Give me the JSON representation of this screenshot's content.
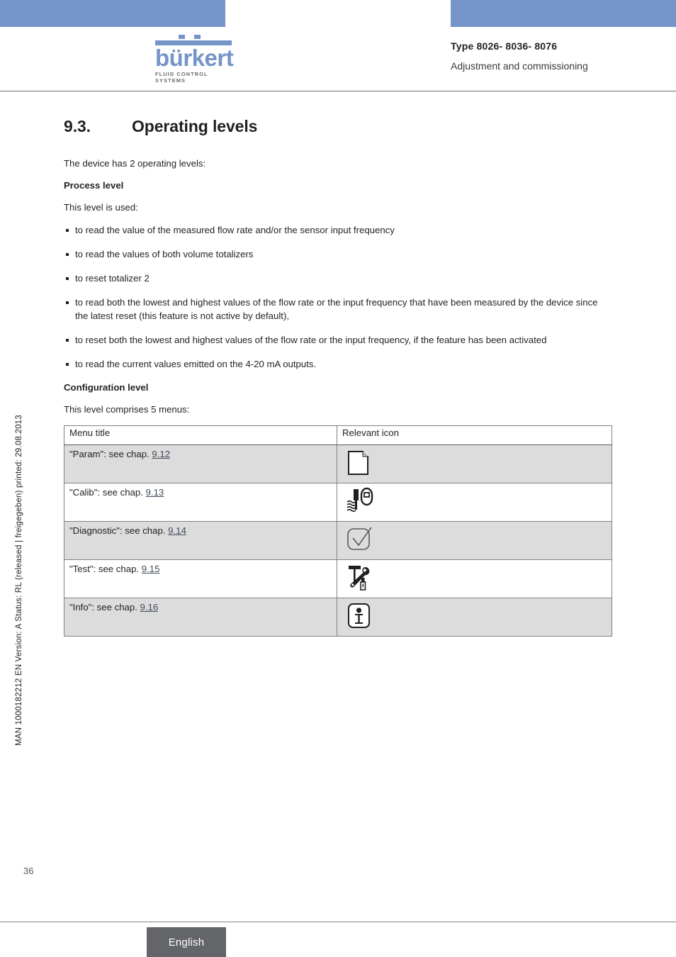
{
  "header": {
    "logo_word": "bürkert",
    "logo_tagline": "FLUID CONTROL SYSTEMS",
    "type_line": "Type 8026- 8036- 8076",
    "subtitle": "Adjustment and commissioning",
    "bar_color": "#7594c8"
  },
  "side_meta": "MAN 1000182212  EN  Version: A  Status: RL (released | freigegeben)  printed: 29.08.2013",
  "section": {
    "number": "9.3.",
    "title": "Operating levels",
    "intro": "The device has 2 operating levels:"
  },
  "process_level": {
    "heading": "Process level",
    "lead": "This level is used:",
    "bullets": [
      "to read the value of the measured flow rate and/or the sensor input frequency",
      "to read the values of both volume totalizers",
      "to reset totalizer 2",
      "to read both the lowest and highest values of the flow rate or the input frequency that have been measured by the device since the latest reset (this feature is not active by default),",
      "to reset both the lowest and highest values of the flow rate or the input frequency, if the feature has been activated",
      "to read the current values emitted on the 4-20 mA outputs."
    ]
  },
  "configuration_level": {
    "heading": "Configuration level",
    "lead": "This level comprises 5 menus:"
  },
  "menu_table": {
    "headers": {
      "title": "Menu title",
      "icon": "Relevant icon"
    },
    "rows": [
      {
        "prefix": "\"Param\": see chap. ",
        "chapter": "9.12",
        "icon_name": "document-page-icon"
      },
      {
        "prefix": "\"Calib\": see chap. ",
        "chapter": "9.13",
        "icon_name": "probe-in-liquid-icon"
      },
      {
        "prefix": "\"Diagnostic\": see chap. ",
        "chapter": "9.14",
        "icon_name": "checkmark-square-icon"
      },
      {
        "prefix": "\"Test\": see chap. ",
        "chapter": "9.15",
        "icon_name": "tools-icon"
      },
      {
        "prefix": "\"Info\": see chap. ",
        "chapter": "9.16",
        "icon_name": "info-square-icon"
      }
    ]
  },
  "footer": {
    "page_number": "36",
    "language": "English",
    "language_box_color": "#636569"
  }
}
